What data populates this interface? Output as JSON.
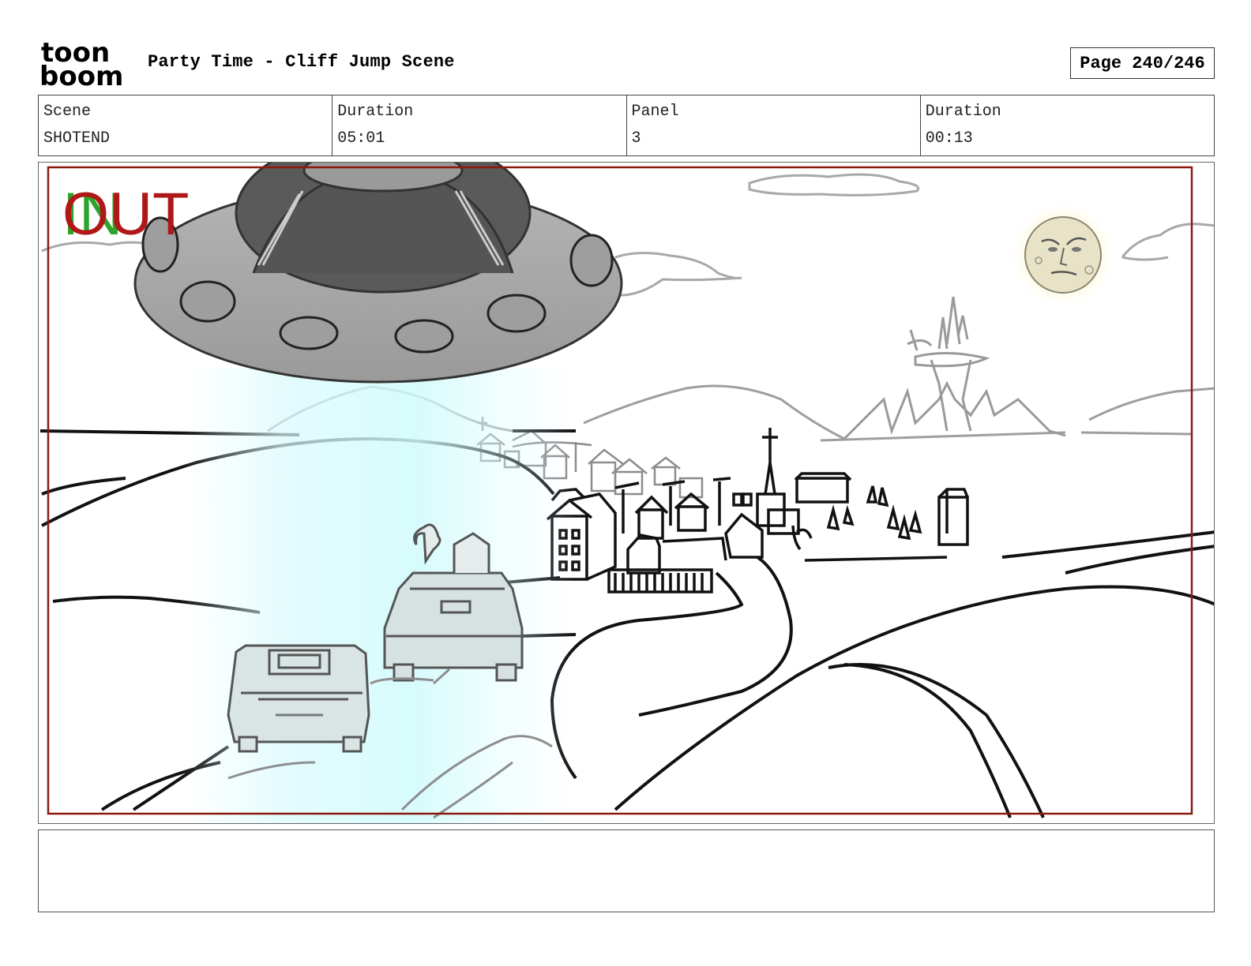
{
  "header": {
    "logo_text_top": "toon",
    "logo_text_bottom": "boom",
    "title": "Party Time - Cliff Jump Scene",
    "page_label": "Page 240/246"
  },
  "info": [
    {
      "label": "Scene",
      "value": "SHOTEND"
    },
    {
      "label": "Duration",
      "value": "05:01"
    },
    {
      "label": "Panel",
      "value": "3"
    },
    {
      "label": "Duration",
      "value": "00:13"
    }
  ],
  "panel": {
    "in_marker": "IN",
    "out_marker": "OUT",
    "in_color": "#2aa52a",
    "out_color": "#b01818",
    "frame_color": "#8a1a10"
  },
  "notes": {
    "text": ""
  }
}
